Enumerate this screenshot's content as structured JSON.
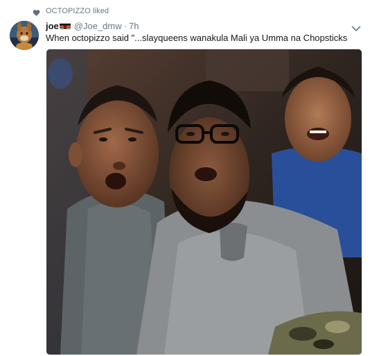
{
  "social_context": {
    "text": "OCTOPIZZO liked",
    "icon": "heart-icon"
  },
  "tweet": {
    "display_name": "joe",
    "flag": "kenya-flag-icon",
    "handle": "@Joe_dmw",
    "separator": "·",
    "time": "7h",
    "text": "When octopizzo said \"...slayqueens wanakula Mali ya Umma na Chopsticks",
    "caret_icon": "chevron-down-icon"
  },
  "colors": {
    "secondary_text": "#657786",
    "primary_text": "#14171a",
    "heart": "#5b7083"
  }
}
